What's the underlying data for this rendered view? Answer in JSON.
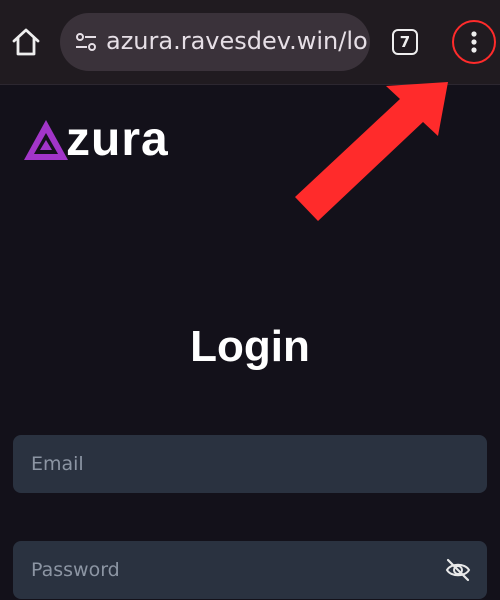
{
  "browser": {
    "url": "azura.ravesdev.win/lo",
    "tab_count": "7",
    "icons": {
      "home": "home-icon",
      "site_settings": "tune-icon",
      "menu": "more-vert-icon"
    }
  },
  "annotation": {
    "arrow_color": "#ff2b2b",
    "highlight_color": "#ff2b2b"
  },
  "brand": {
    "name": "zura",
    "mark_color": "#a235c9"
  },
  "login": {
    "title": "Login",
    "email_placeholder": "Email",
    "password_placeholder": "Password",
    "password_toggle_icon": "eye-off-icon"
  },
  "colors": {
    "background": "#13111a",
    "field_background": "#2a3240",
    "browser_bar": "#201b20"
  }
}
